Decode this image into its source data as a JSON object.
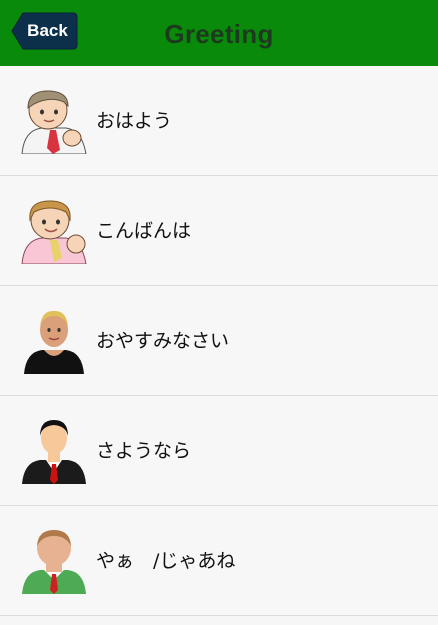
{
  "header": {
    "back_label": "Back",
    "title": "Greeting",
    "background": "#098a0a",
    "back_button_color": "#0c2f4a"
  },
  "list": {
    "items": [
      {
        "label": "おはよう",
        "avatar": "person-icon"
      },
      {
        "label": "こんばんは",
        "avatar": "person-icon"
      },
      {
        "label": "おやすみなさい",
        "avatar": "person-icon"
      },
      {
        "label": "さようなら",
        "avatar": "person-icon"
      },
      {
        "label": "やぁ　/じゃあね",
        "avatar": "person-icon"
      }
    ]
  }
}
